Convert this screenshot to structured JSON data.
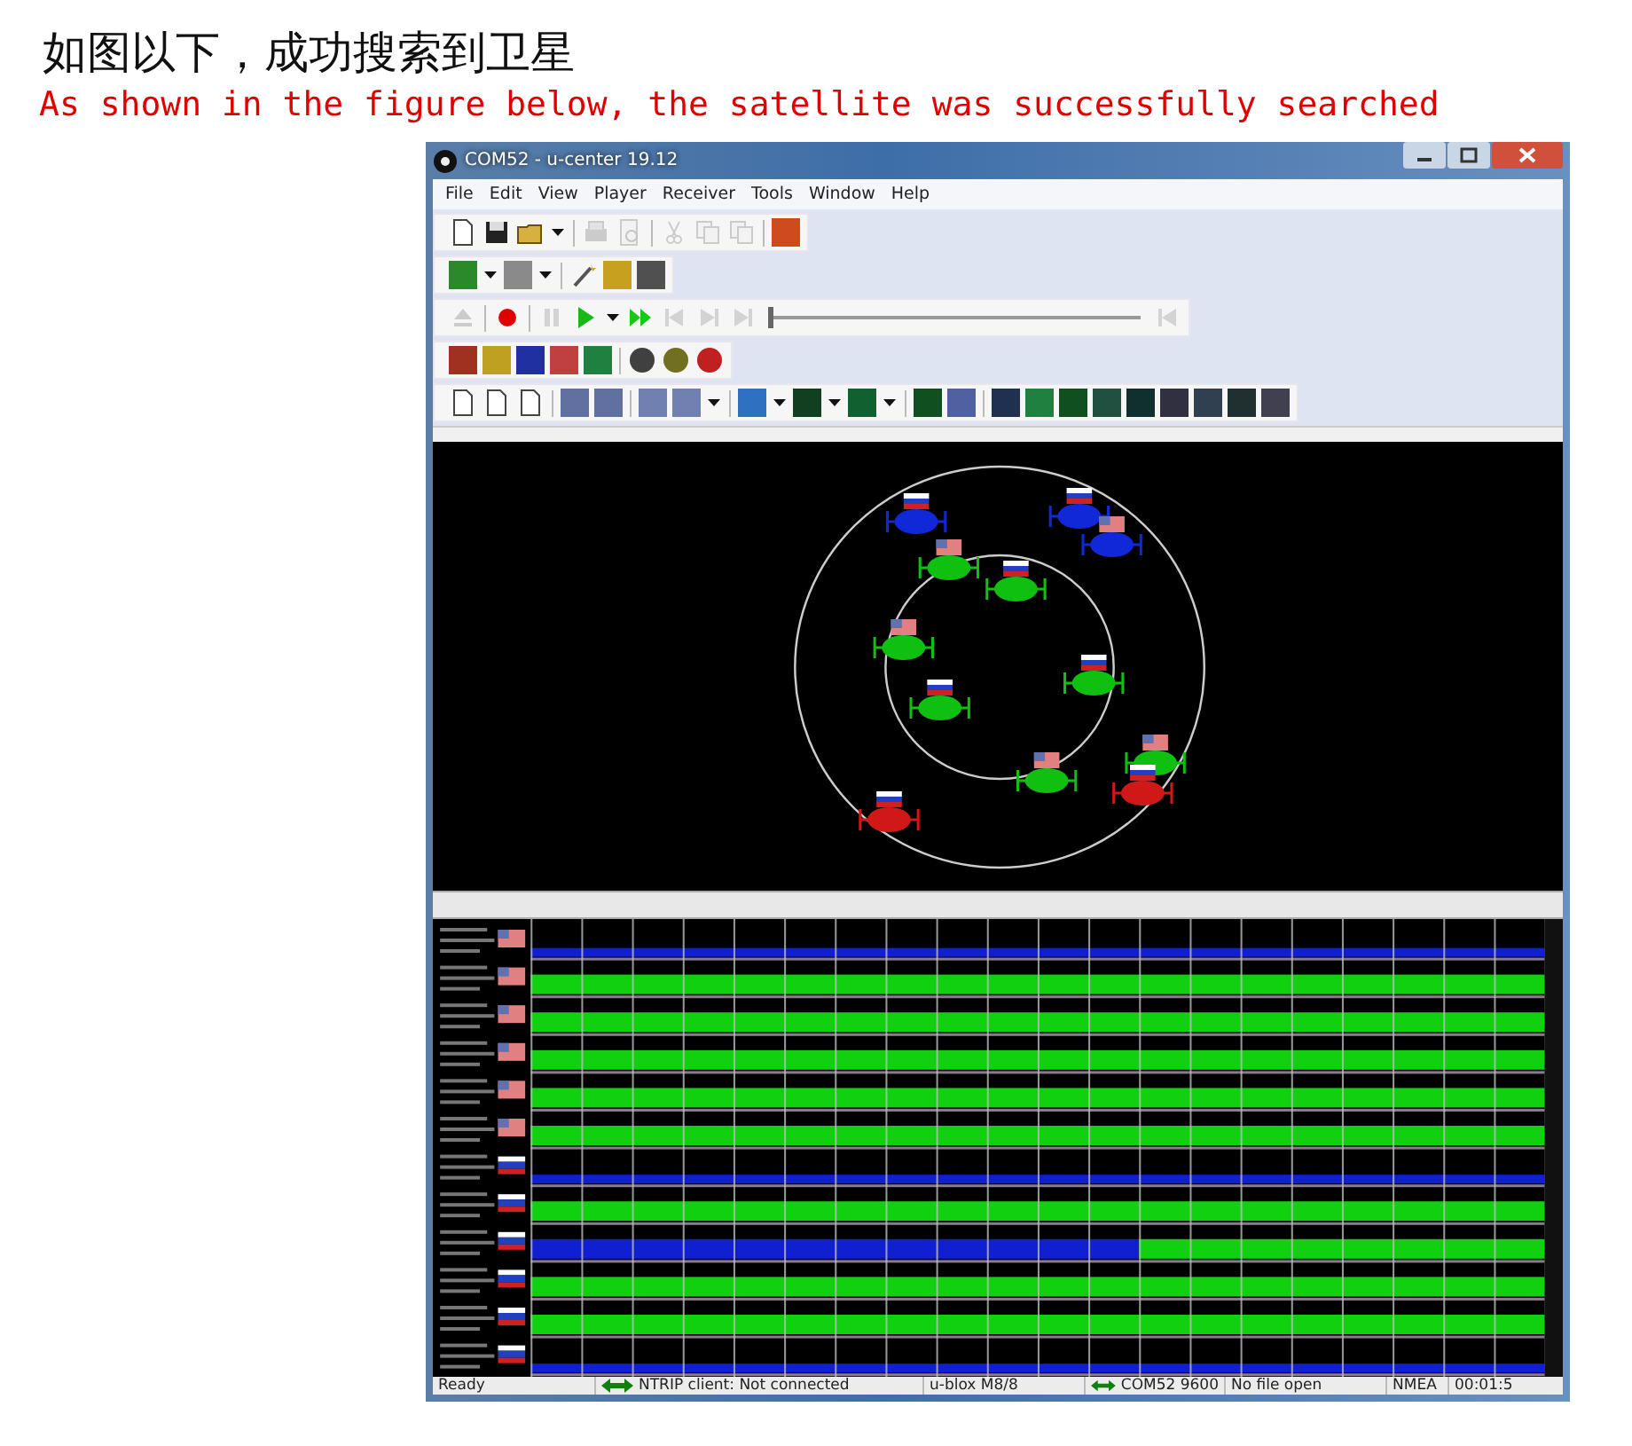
{
  "heading": "如图以下，成功搜索到卫星",
  "subheading": "As shown in the figure below, the satellite was successfully searched",
  "window": {
    "title": "COM52 - u-center 19.12"
  },
  "menu": [
    "File",
    "Edit",
    "View",
    "Player",
    "Receiver",
    "Tools",
    "Window",
    "Help"
  ],
  "toolbars": [
    [
      {
        "kind": "doc",
        "disabled": false
      },
      {
        "kind": "save",
        "disabled": false
      },
      {
        "kind": "folder",
        "disabled": false
      },
      {
        "kind": "caret",
        "disabled": false
      },
      {
        "kind": "separator"
      },
      {
        "kind": "printer",
        "disabled": true
      },
      {
        "kind": "preview",
        "disabled": true
      },
      {
        "kind": "separator"
      },
      {
        "kind": "cut",
        "disabled": true
      },
      {
        "kind": "copy",
        "disabled": true
      },
      {
        "kind": "copy",
        "disabled": true
      },
      {
        "kind": "separator"
      },
      {
        "kind": "tile",
        "color": "#d04a20",
        "disabled": false
      }
    ],
    [
      {
        "kind": "tile",
        "color": "#2a8a2a",
        "disabled": false
      },
      {
        "kind": "caret",
        "disabled": false
      },
      {
        "kind": "tile",
        "color": "#8a8a8a",
        "disabled": false
      },
      {
        "kind": "caret",
        "disabled": false
      },
      {
        "kind": "separator"
      },
      {
        "kind": "wand",
        "disabled": false
      },
      {
        "kind": "tile",
        "color": "#c8a020",
        "disabled": false
      },
      {
        "kind": "tile",
        "color": "#505050",
        "disabled": false
      }
    ],
    [
      {
        "kind": "eject",
        "disabled": true
      },
      {
        "kind": "separator"
      },
      {
        "kind": "record",
        "disabled": false
      },
      {
        "kind": "separator"
      },
      {
        "kind": "pause",
        "disabled": true
      },
      {
        "kind": "play",
        "disabled": false
      },
      {
        "kind": "caret",
        "disabled": false
      },
      {
        "kind": "fastforward",
        "disabled": false
      },
      {
        "kind": "stepback",
        "disabled": true
      },
      {
        "kind": "step",
        "disabled": true
      },
      {
        "kind": "step",
        "disabled": true
      },
      {
        "kind": "slider",
        "level": 0
      },
      {
        "kind": "stepback",
        "disabled": true
      }
    ],
    [
      {
        "kind": "tile",
        "color": "#a03020",
        "disabled": false
      },
      {
        "kind": "tile",
        "color": "#c0a020",
        "disabled": false
      },
      {
        "kind": "tile",
        "color": "#2030a0",
        "disabled": false
      },
      {
        "kind": "tile",
        "color": "#c04040",
        "disabled": false
      },
      {
        "kind": "tile",
        "color": "#208040",
        "disabled": false
      },
      {
        "kind": "separator"
      },
      {
        "kind": "dot",
        "color": "#404040",
        "disabled": false
      },
      {
        "kind": "dot",
        "color": "#707020",
        "disabled": false
      },
      {
        "kind": "dot",
        "color": "#c02020",
        "disabled": false
      }
    ],
    [
      {
        "kind": "doc",
        "disabled": false
      },
      {
        "kind": "doc",
        "disabled": false
      },
      {
        "kind": "doc",
        "disabled": false
      },
      {
        "kind": "separator"
      },
      {
        "kind": "tile",
        "color": "#6070a0",
        "disabled": false
      },
      {
        "kind": "tile",
        "color": "#6070a0",
        "disabled": false
      },
      {
        "kind": "separator"
      },
      {
        "kind": "tile",
        "color": "#7080b0",
        "disabled": false
      },
      {
        "kind": "tile",
        "color": "#7080b0",
        "disabled": false
      },
      {
        "kind": "caret",
        "disabled": false
      },
      {
        "kind": "separator"
      },
      {
        "kind": "tile",
        "color": "#3070c0",
        "disabled": false
      },
      {
        "kind": "caret",
        "disabled": false
      },
      {
        "kind": "tile",
        "color": "#104020",
        "disabled": false
      },
      {
        "kind": "caret",
        "disabled": false
      },
      {
        "kind": "tile",
        "color": "#106030",
        "disabled": false
      },
      {
        "kind": "caret",
        "disabled": false
      },
      {
        "kind": "separator"
      },
      {
        "kind": "tile",
        "color": "#105020",
        "disabled": false
      },
      {
        "kind": "tile",
        "color": "#5060a0",
        "disabled": false
      },
      {
        "kind": "separator"
      },
      {
        "kind": "tile",
        "color": "#203050",
        "disabled": false
      },
      {
        "kind": "tile",
        "color": "#208040",
        "disabled": false
      },
      {
        "kind": "tile",
        "color": "#105020",
        "disabled": false
      },
      {
        "kind": "tile",
        "color": "#205040",
        "disabled": false
      },
      {
        "kind": "tile",
        "color": "#103030",
        "disabled": false
      },
      {
        "kind": "tile",
        "color": "#303040",
        "disabled": false
      },
      {
        "kind": "tile",
        "color": "#304050",
        "disabled": false
      },
      {
        "kind": "tile",
        "color": "#203030",
        "disabled": false
      },
      {
        "kind": "tile",
        "color": "#404050",
        "disabled": false
      }
    ]
  ],
  "status_bar": [
    {
      "kind": "text",
      "text": "Ready"
    },
    {
      "kind": "link",
      "text": "NTRIP client: Not connected"
    },
    {
      "kind": "text",
      "text": "u-blox M8/8"
    },
    {
      "kind": "link",
      "text": "COM52 9600"
    },
    {
      "kind": "text",
      "text": "No file open"
    },
    {
      "kind": "text",
      "text": "NMEA"
    },
    {
      "kind": "text",
      "text": "00:01:5"
    }
  ]
}
